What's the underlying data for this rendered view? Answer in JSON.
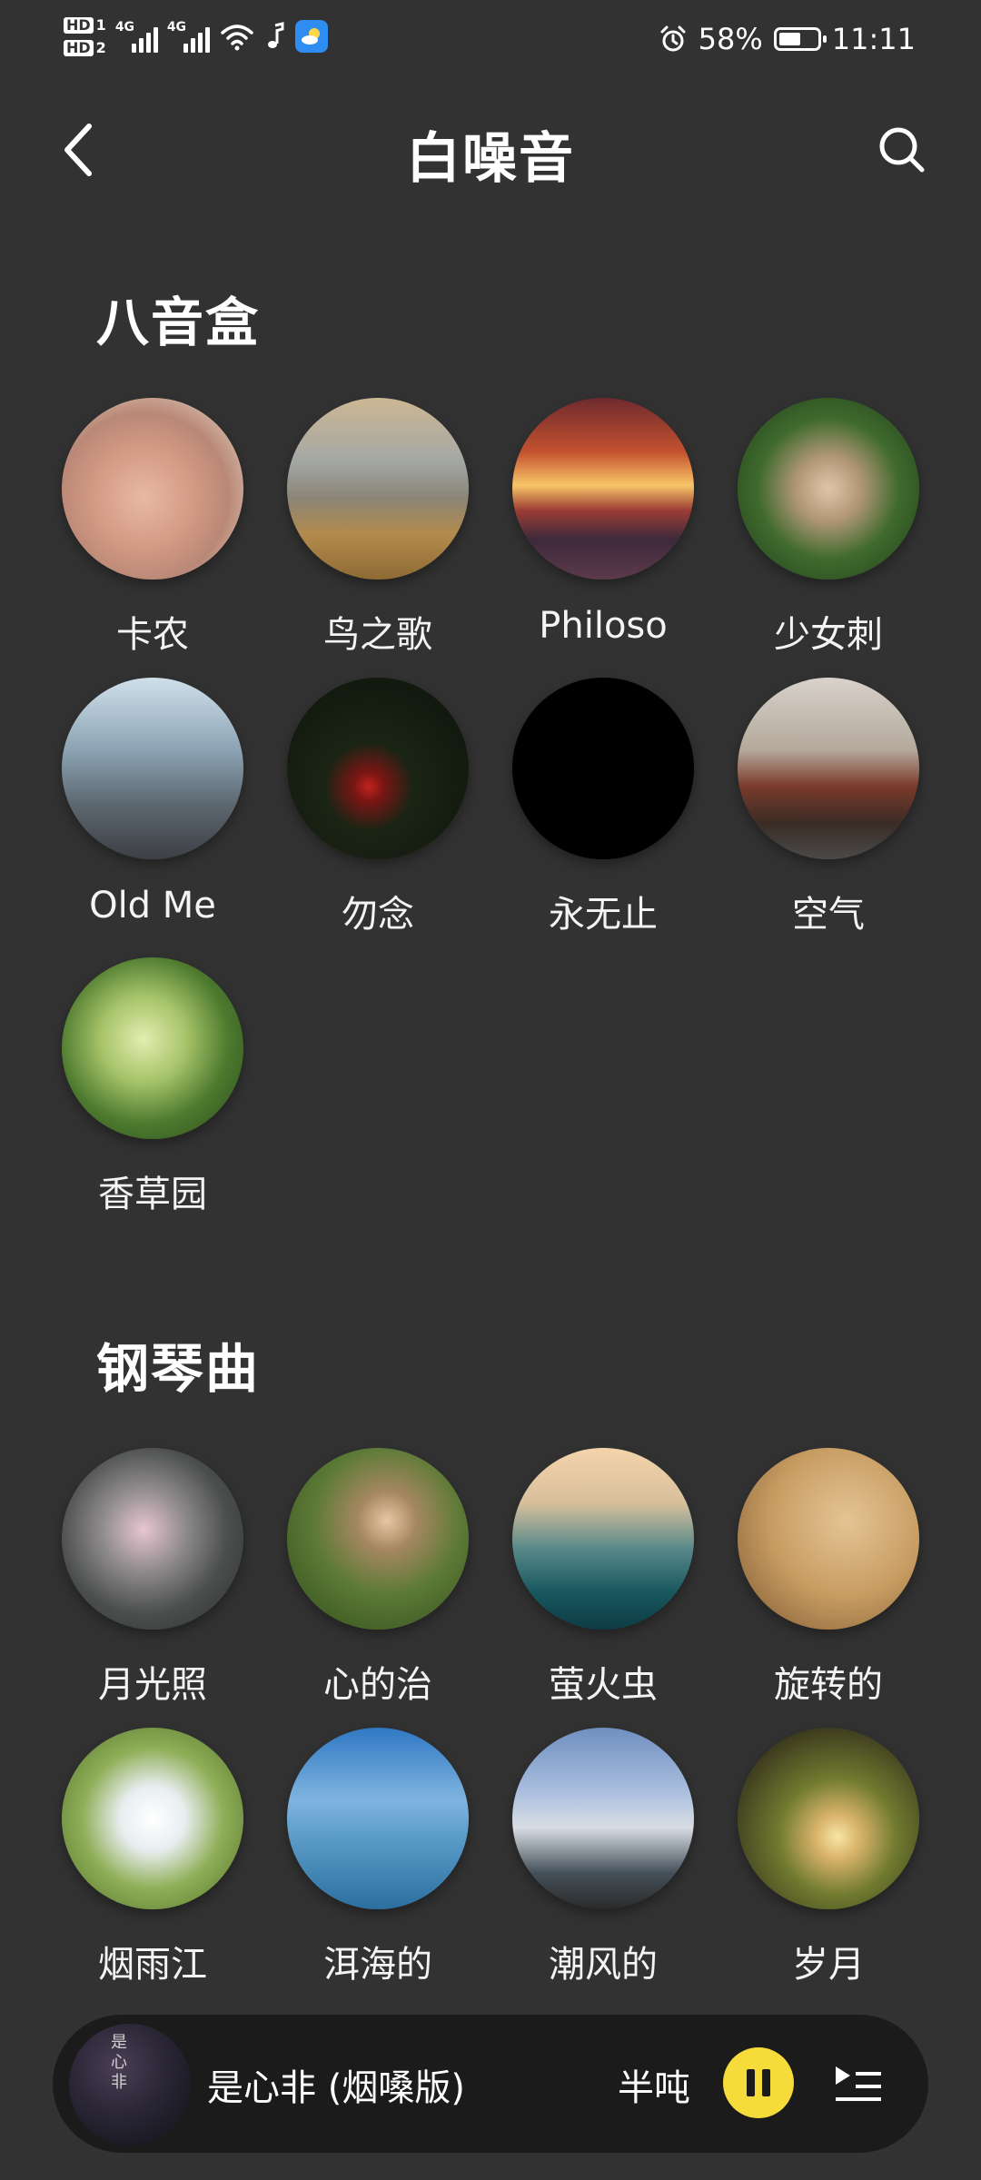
{
  "status_bar": {
    "sim1_label": "HD",
    "sim1_index": "1",
    "sim2_label": "HD",
    "sim2_index": "2",
    "net1": "4G",
    "net2": "4G",
    "battery_percent": "58%",
    "battery_level": 0.58,
    "time": "11:11",
    "icons": [
      "signal-icon",
      "wifi-icon",
      "music-note-icon",
      "weather-app-icon",
      "alarm-icon",
      "battery-icon"
    ]
  },
  "header": {
    "title": "白噪音",
    "back_icon": "chevron-left-icon",
    "search_icon": "search-icon"
  },
  "sections": [
    {
      "title": "八音盒",
      "items": [
        {
          "label": "卡农"
        },
        {
          "label": "鸟之歌"
        },
        {
          "label": "Philoso"
        },
        {
          "label": "少女刺"
        },
        {
          "label": "Old Me"
        },
        {
          "label": "勿念"
        },
        {
          "label": "永无止"
        },
        {
          "label": "空气"
        },
        {
          "label": "香草园"
        }
      ]
    },
    {
      "title": "钢琴曲",
      "items": [
        {
          "label": "月光照"
        },
        {
          "label": "心的治"
        },
        {
          "label": "萤火虫"
        },
        {
          "label": "旋转的"
        },
        {
          "label": "烟雨江"
        },
        {
          "label": "洱海的"
        },
        {
          "label": "潮风的"
        },
        {
          "label": "岁月"
        }
      ]
    }
  ],
  "player": {
    "art_text": "是心非",
    "track_title": "是心非 (烟嗓版)",
    "artist": "半吨",
    "state": "playing",
    "accent_color": "#f5dc3a"
  }
}
